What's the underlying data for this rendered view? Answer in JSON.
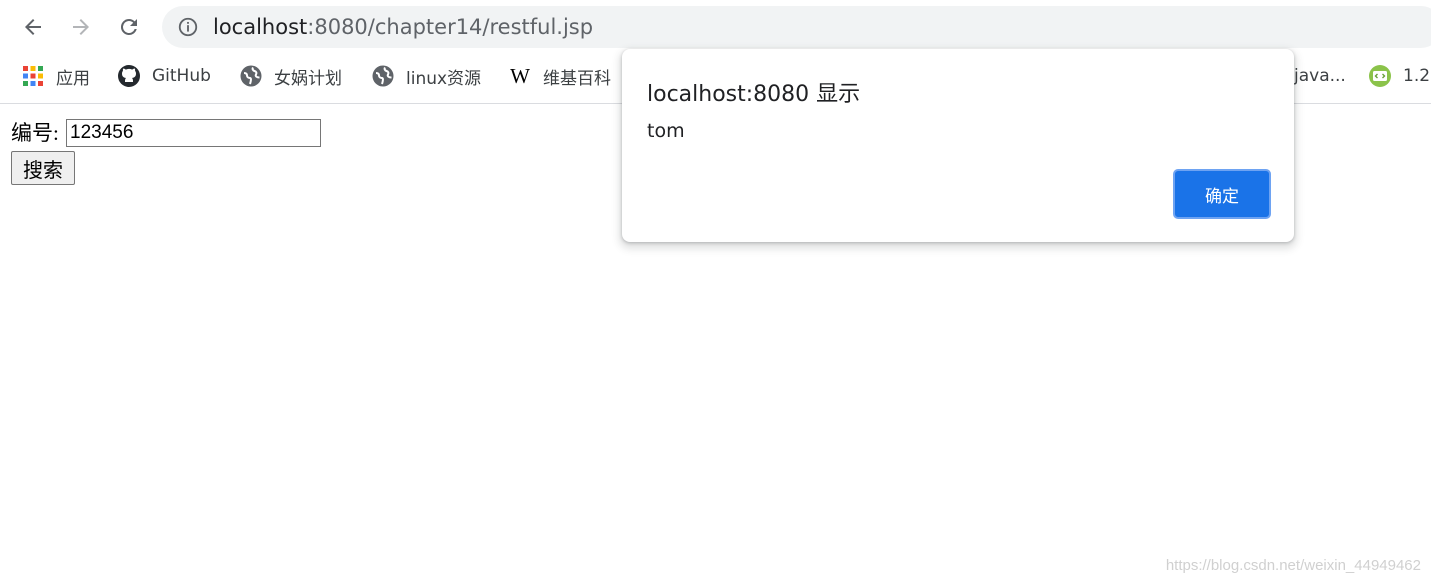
{
  "browser": {
    "url_host": "localhost",
    "url_path": ":8080/chapter14/restful.jsp",
    "bookmarks": [
      {
        "label": "应用",
        "icon": "apps-grid-icon"
      },
      {
        "label": "GitHub",
        "icon": "github-icon"
      },
      {
        "label": "女娲计划",
        "icon": "globe-icon"
      },
      {
        "label": "linux资源",
        "icon": "globe-icon"
      },
      {
        "label": "维基百科",
        "icon": "wikipedia-icon"
      },
      {
        "label": "java...",
        "icon": ""
      },
      {
        "label": "1.2",
        "icon": "code-icon"
      }
    ]
  },
  "page": {
    "id_label": "编号:",
    "id_value": "123456",
    "search_label": "搜索"
  },
  "dialog": {
    "title": "localhost:8080 显示",
    "message": "tom",
    "ok_label": "确定"
  },
  "watermark": "https://blog.csdn.net/weixin_44949462",
  "colors": {
    "accent": "#1a73e8",
    "omnibox_bg": "#f1f3f4"
  }
}
